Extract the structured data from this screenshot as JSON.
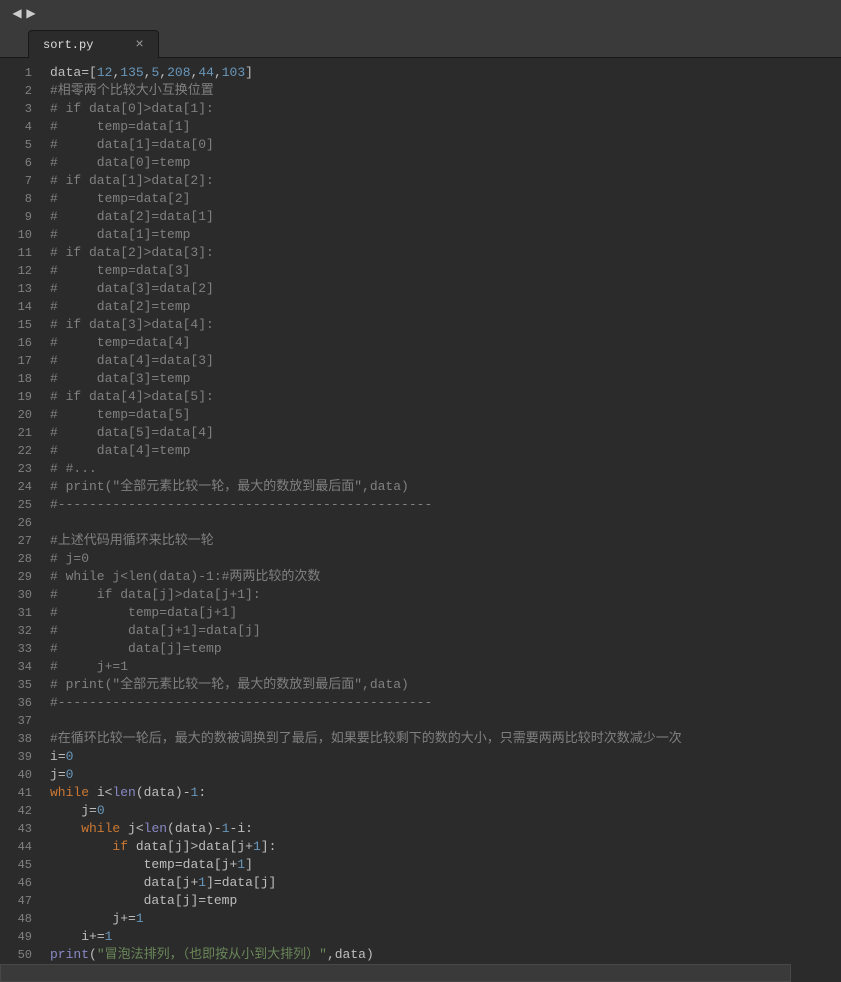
{
  "tab": {
    "title": "sort.py",
    "close": "×"
  },
  "nav": {
    "back": "◀",
    "fwd": "▶"
  },
  "gutter_count": 51,
  "highlight_line": 51,
  "code": [
    [
      [
        "var",
        "data"
      ],
      [
        "op",
        "="
      ],
      [
        "brk",
        "["
      ],
      [
        "num",
        "12"
      ],
      [
        "punc",
        ","
      ],
      [
        "num",
        "135"
      ],
      [
        "punc",
        ","
      ],
      [
        "num",
        "5"
      ],
      [
        "punc",
        ","
      ],
      [
        "num",
        "208"
      ],
      [
        "punc",
        ","
      ],
      [
        "num",
        "44"
      ],
      [
        "punc",
        ","
      ],
      [
        "num",
        "103"
      ],
      [
        "brk",
        "]"
      ]
    ],
    [
      [
        "cmt",
        "#相零两个比较大小互换位置"
      ]
    ],
    [
      [
        "cmt",
        "# if data[0]>data[1]:"
      ]
    ],
    [
      [
        "cmt",
        "#     temp=data[1]"
      ]
    ],
    [
      [
        "cmt",
        "#     data[1]=data[0]"
      ]
    ],
    [
      [
        "cmt",
        "#     data[0]=temp"
      ]
    ],
    [
      [
        "cmt",
        "# if data[1]>data[2]:"
      ]
    ],
    [
      [
        "cmt",
        "#     temp=data[2]"
      ]
    ],
    [
      [
        "cmt",
        "#     data[2]=data[1]"
      ]
    ],
    [
      [
        "cmt",
        "#     data[1]=temp"
      ]
    ],
    [
      [
        "cmt",
        "# if data[2]>data[3]:"
      ]
    ],
    [
      [
        "cmt",
        "#     temp=data[3]"
      ]
    ],
    [
      [
        "cmt",
        "#     data[3]=data[2]"
      ]
    ],
    [
      [
        "cmt",
        "#     data[2]=temp"
      ]
    ],
    [
      [
        "cmt",
        "# if data[3]>data[4]:"
      ]
    ],
    [
      [
        "cmt",
        "#     temp=data[4]"
      ]
    ],
    [
      [
        "cmt",
        "#     data[4]=data[3]"
      ]
    ],
    [
      [
        "cmt",
        "#     data[3]=temp"
      ]
    ],
    [
      [
        "cmt",
        "# if data[4]>data[5]:"
      ]
    ],
    [
      [
        "cmt",
        "#     temp=data[5]"
      ]
    ],
    [
      [
        "cmt",
        "#     data[5]=data[4]"
      ]
    ],
    [
      [
        "cmt",
        "#     data[4]=temp"
      ]
    ],
    [
      [
        "cmt",
        "# #..."
      ]
    ],
    [
      [
        "cmt",
        "# print(\"全部元素比较一轮，最大的数放到最后面\",data)"
      ]
    ],
    [
      [
        "cmt",
        "#------------------------------------------------"
      ]
    ],
    [],
    [
      [
        "cmt",
        "#上述代码用循环来比较一轮"
      ]
    ],
    [
      [
        "cmt",
        "# j=0"
      ]
    ],
    [
      [
        "cmt",
        "# while j<len(data)-1:#两两比较的次数"
      ]
    ],
    [
      [
        "cmt",
        "#     if data[j]>data[j+1]:"
      ]
    ],
    [
      [
        "cmt",
        "#         temp=data[j+1]"
      ]
    ],
    [
      [
        "cmt",
        "#         data[j+1]=data[j]"
      ]
    ],
    [
      [
        "cmt",
        "#         data[j]=temp"
      ]
    ],
    [
      [
        "cmt",
        "#     j+=1"
      ]
    ],
    [
      [
        "cmt",
        "# print(\"全部元素比较一轮，最大的数放到最后面\",data)"
      ]
    ],
    [
      [
        "cmt",
        "#------------------------------------------------"
      ]
    ],
    [],
    [
      [
        "cmt",
        "#在循环比较一轮后，最大的数被调换到了最后，如果要比较剩下的数的大小，只需要两两比较时次数减少一次"
      ]
    ],
    [
      [
        "var",
        "i"
      ],
      [
        "op",
        "="
      ],
      [
        "num",
        "0"
      ]
    ],
    [
      [
        "var",
        "j"
      ],
      [
        "op",
        "="
      ],
      [
        "num",
        "0"
      ]
    ],
    [
      [
        "kw",
        "while "
      ],
      [
        "var",
        "i"
      ],
      [
        "op",
        "<"
      ],
      [
        "fn",
        "len"
      ],
      [
        "brk",
        "("
      ],
      [
        "var",
        "data"
      ],
      [
        "brk",
        ")"
      ],
      [
        "op",
        "-"
      ],
      [
        "num",
        "1"
      ],
      [
        "punc",
        ":"
      ]
    ],
    [
      [
        "var",
        "    j"
      ],
      [
        "op",
        "="
      ],
      [
        "num",
        "0"
      ]
    ],
    [
      [
        "kw",
        "    while "
      ],
      [
        "var",
        "j"
      ],
      [
        "op",
        "<"
      ],
      [
        "fn",
        "len"
      ],
      [
        "brk",
        "("
      ],
      [
        "var",
        "data"
      ],
      [
        "brk",
        ")"
      ],
      [
        "op",
        "-"
      ],
      [
        "num",
        "1"
      ],
      [
        "op",
        "-"
      ],
      [
        "var",
        "i"
      ],
      [
        "punc",
        ":"
      ]
    ],
    [
      [
        "kw",
        "        if "
      ],
      [
        "var",
        "data"
      ],
      [
        "brk",
        "["
      ],
      [
        "var",
        "j"
      ],
      [
        "brk",
        "]"
      ],
      [
        "op",
        ">"
      ],
      [
        "var",
        "data"
      ],
      [
        "brk",
        "["
      ],
      [
        "var",
        "j"
      ],
      [
        "op",
        "+"
      ],
      [
        "num",
        "1"
      ],
      [
        "brk",
        "]"
      ],
      [
        "punc",
        ":"
      ]
    ],
    [
      [
        "var",
        "            temp"
      ],
      [
        "op",
        "="
      ],
      [
        "var",
        "data"
      ],
      [
        "brk",
        "["
      ],
      [
        "var",
        "j"
      ],
      [
        "op",
        "+"
      ],
      [
        "num",
        "1"
      ],
      [
        "brk",
        "]"
      ]
    ],
    [
      [
        "var",
        "            data"
      ],
      [
        "brk",
        "["
      ],
      [
        "var",
        "j"
      ],
      [
        "op",
        "+"
      ],
      [
        "num",
        "1"
      ],
      [
        "brk",
        "]"
      ],
      [
        "op",
        "="
      ],
      [
        "var",
        "data"
      ],
      [
        "brk",
        "["
      ],
      [
        "var",
        "j"
      ],
      [
        "brk",
        "]"
      ]
    ],
    [
      [
        "var",
        "            data"
      ],
      [
        "brk",
        "["
      ],
      [
        "var",
        "j"
      ],
      [
        "brk",
        "]"
      ],
      [
        "op",
        "="
      ],
      [
        "var",
        "temp"
      ]
    ],
    [
      [
        "var",
        "        j"
      ],
      [
        "op",
        "+="
      ],
      [
        "num",
        "1"
      ]
    ],
    [
      [
        "var",
        "    i"
      ],
      [
        "op",
        "+="
      ],
      [
        "num",
        "1"
      ]
    ],
    [
      [
        "fn",
        "print"
      ],
      [
        "brk",
        "("
      ],
      [
        "str",
        "\"冒泡法排列，（也即按从小到大排列）\""
      ],
      [
        "punc",
        ","
      ],
      [
        "var",
        "data"
      ],
      [
        "brk",
        ")"
      ]
    ],
    []
  ]
}
